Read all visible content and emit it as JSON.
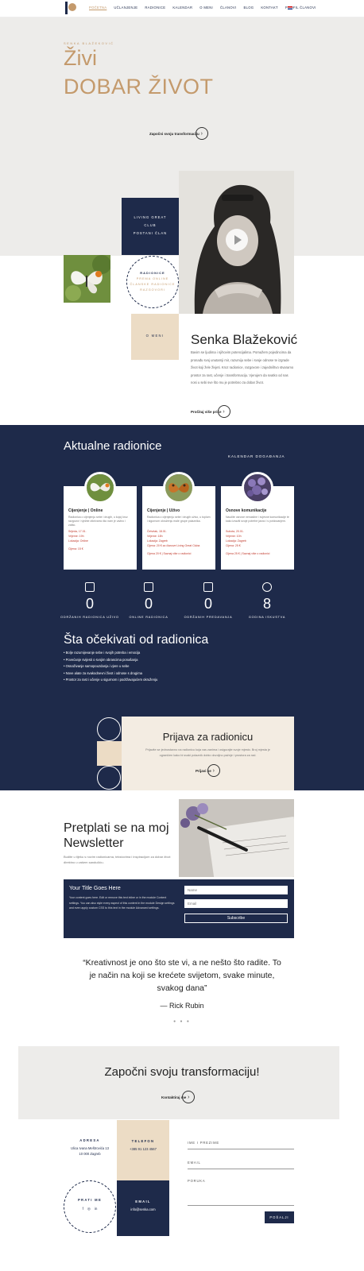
{
  "header": {
    "nav": [
      "POČETNA",
      "UČLANJENJE",
      "RADIONICE",
      "KALENDAR",
      "O MENI",
      "ČLANOVI",
      "BLOG",
      "KONTAKT",
      "PROFIL ČLANOVI"
    ]
  },
  "hero": {
    "kicker": "SENKA BLAŽEKOVIĆ",
    "title_line1": "Živi",
    "title_line2": "DOBAR ŽIVOT",
    "cta": "Započni svoju transformaciju"
  },
  "about": {
    "navy_box": [
      "LIVING GREAT",
      "CLUB",
      "POSTANI ČLAN"
    ],
    "radionice_label": "RADIONICE",
    "radionice_links": [
      "PREMA ONLINE",
      "ČLANSKE RADIONICE",
      "RAZGOVORI"
    ],
    "o_meni": "O MENI",
    "name": "Senka Blažeković",
    "bio": "Bavim se ljudima i njihovim potencijalima. Pomažem pojedincima da pronađu svoj unutarnji mir, razumiju sebe i svoje odnose te izgrade život koji žele živjeti. Kroz radionice, razgovore i zajedništvo stvaramo prostor za rast, učenje i transformaciju. Vjerujem da svatko od nas nosi u sebi sve što mu je potrebno za dobar život.",
    "cta": "Pročitaj više priče"
  },
  "workshops": {
    "title": "Aktualne radionice",
    "calendar_link": "KALENDAR DOGAĐANJA",
    "cards": [
      {
        "title": "Cijenjenje | Online",
        "desc": "Radionica o cijenjenju sebe i drugih, u kojoj kroz razgovor i vježbe otkrivamo što nam je važno i zašto.",
        "date": "Srijeda, 17.01.",
        "time": "Vrijeme: 19h",
        "place": "Lokacija: Online",
        "price": "Cijena: 15 €",
        "more": "Cijena 15 € | Saznaj više"
      },
      {
        "title": "Cijenjenje | Uživo",
        "desc": "Radionica o cijenjenju sebe i drugih uživo, u toplom i sigurnom okruženju male grupe polaznika.",
        "date": "Četvrtak, 18.01.",
        "time": "Vrijeme: 18h",
        "place": "Lokacija: Zagreb",
        "price": "Cijena: 20 € za članove Living Great Cluba",
        "more": "Cijena 20 € | Saznaj više o radionici"
      },
      {
        "title": "Osnove komunikacije",
        "desc": "Naučite osnove nenasilne i svjesne komunikacije te kako izraziti svoje potrebe jasno i s poštovanjem.",
        "date": "Subota, 20.01.",
        "time": "Vrijeme: 10h",
        "place": "Lokacija: Zagreb",
        "price": "Cijena: 25 €",
        "more": "Cijena 25 € | Saznaj više o radionici"
      }
    ]
  },
  "stats": [
    {
      "num": "0",
      "label": "ODRŽANIH RADIONICA UŽIVO"
    },
    {
      "num": "0",
      "label": "ONLINE RADIONICA"
    },
    {
      "num": "0",
      "label": "ODRŽANIH PREDAVANJA"
    },
    {
      "num": "8",
      "label": "GODINA ISKUSTVA"
    }
  ],
  "expect": {
    "title": "Šta očekivati od radionica",
    "items": [
      "Bolje razumijevanje sebe i svojih potreba i emocija",
      "Povećanje svijesti o svojim obrascima ponašanja",
      "Osnaživanje samopouzdanja i vjere u sebe",
      "Nove alate za svakodnevni život i odnose s drugima",
      "Prostor za rast i učenje u sigurnom i podržavajućem okruženju"
    ]
  },
  "prijava": {
    "title": "Prijava za radionicu",
    "desc": "Prijavite se jednostavno na radionicu koja vas zanima i osigurajte svoje mjesto. Broj mjesta je ograničen kako bi svaki polaznik dobio dovoljno pažnje i prostora za rad.",
    "cta": "Prijavi se"
  },
  "newsletter": {
    "title_line1": "Pretplati se na moj",
    "title_line2": "Newsletter",
    "desc": "Budite u tijeku s novim radionicama, tekstovima i inspiracijom za dobar život direktno u vašem sandučiću.",
    "form_title": "Your Title Goes Here",
    "form_desc": "Your content goes here. Edit or remove this text inline or in the module Content settings. You can also style every aspect of this content in the module Design settings and even apply custom CSS to this text in the module Advanced settings.",
    "name_placeholder": "Name",
    "email_placeholder": "Email",
    "subscribe": "Subscribe"
  },
  "quote": {
    "text": "“Kreativnost je ono što ste vi, a ne nešto što radite. To je način na koji se krećete svijetom, svake minute, svakog dana”",
    "author": "— Rick Rubin",
    "dots": "● ● ●"
  },
  "transform": {
    "title": "Započni svoju transformaciju!",
    "cta": "Kontaktiraj me"
  },
  "contact": {
    "adresa_label": "ADRESA",
    "adresa_value": [
      "Ulica Ivana Meštrovića 13",
      "10 000 Zagreb"
    ],
    "telefon_label": "TELEFON",
    "telefon_value": "+385 91 123 4567",
    "social_label": "PRATI ME",
    "social_icons": [
      "f",
      "◎",
      "in"
    ],
    "email_label": "EMAIL",
    "email_value": "info@senka.com",
    "form_name": "IME I PREZIME",
    "form_email": "EMAIL",
    "form_message": "PORUKA",
    "submit": "POŠALJI"
  }
}
